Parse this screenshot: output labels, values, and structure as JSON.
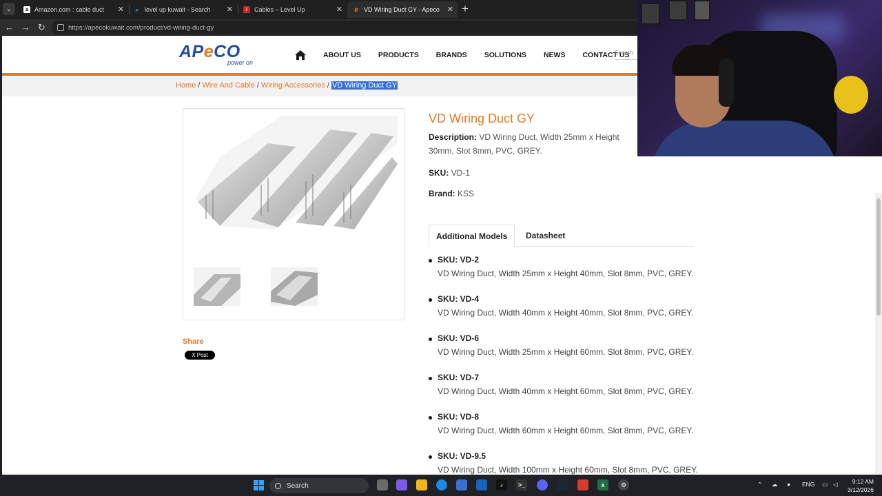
{
  "browser": {
    "tabs": [
      {
        "title": "Amazon.com : cable duct",
        "favicon": "amazon-icon"
      },
      {
        "title": "level up kuwait - Search",
        "favicon": "bing-search-icon"
      },
      {
        "title": "Cables – Level Up",
        "favicon": "levelup-icon"
      },
      {
        "title": "VD Wiring Duct GY - Apeco",
        "favicon": "apeco-icon",
        "active": true
      }
    ],
    "url": "https://apecokuwait.com/product/vd-wiring-duct-gy"
  },
  "site": {
    "logo_word_start": "AP",
    "logo_word_e": "e",
    "logo_word_end": "CO",
    "logo_tagline": "power on",
    "nav": [
      "ABOUT US",
      "PRODUCTS",
      "BRANDS",
      "SOLUTIONS",
      "NEWS",
      "CONTACT US"
    ],
    "search_placeholder": "Search",
    "accent_color": "#e87722",
    "brand_color": "#1d4fa3"
  },
  "breadcrumb": {
    "home": "Home",
    "cat1": "Wire And Cable",
    "cat2": "Wiring Accessories",
    "current": "VD Wiring Duct GY",
    "sep": "/"
  },
  "product": {
    "title": "VD Wiring Duct GY",
    "desc_label": "Description:",
    "desc_text": "VD Wiring Duct, Width 25mm x Height 30mm, Slot 8mm, PVC, GREY.",
    "sku_label": "SKU:",
    "sku": "VD-1",
    "brand_label": "Brand:",
    "brand": "KSS",
    "share_label": "Share",
    "xpost_label": "X Post"
  },
  "tabs": {
    "additional": "Additional Models",
    "datasheet": "Datasheet"
  },
  "models": [
    {
      "sku": "SKU: VD-2",
      "desc": "VD Wiring Duct, Width 25mm x Height 40mm, Slot 8mm, PVC, GREY."
    },
    {
      "sku": "SKU: VD-4",
      "desc": "VD Wiring Duct, Width 40mm x Height 40mm, Slot 8mm, PVC, GREY."
    },
    {
      "sku": "SKU: VD-6",
      "desc": "VD Wiring Duct, Width 25mm x Height 60mm, Slot 8mm, PVC, GREY."
    },
    {
      "sku": "SKU: VD-7",
      "desc": "VD Wiring Duct, Width 40mm x Height 60mm, Slot 8mm, PVC, GREY."
    },
    {
      "sku": "SKU: VD-8",
      "desc": "VD Wiring Duct, Width 60mm x Height 60mm, Slot 8mm, PVC, GREY."
    },
    {
      "sku": "SKU: VD-9.5",
      "desc": "VD Wiring Duct, Width 100mm x Height 60mm, Slot 8mm, PVC, GREY."
    }
  ],
  "taskbar": {
    "search": "Search",
    "lang": "ENG",
    "time": "9:12 AM",
    "date": "3/12/2026"
  }
}
